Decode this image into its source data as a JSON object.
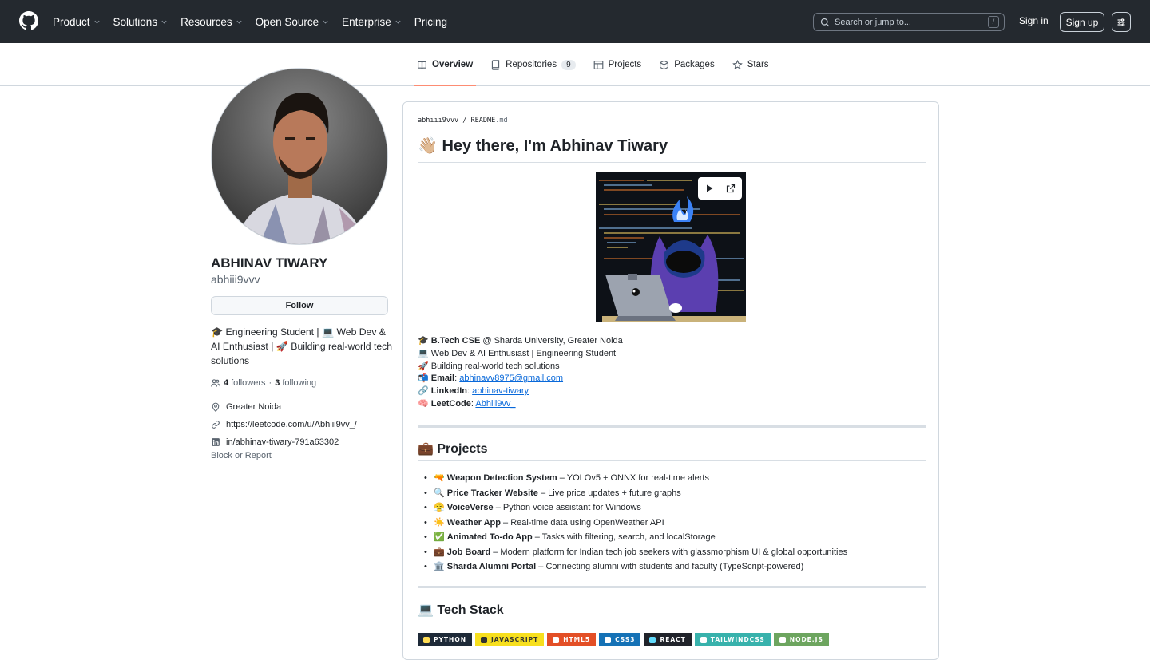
{
  "header": {
    "nav": [
      "Product",
      "Solutions",
      "Resources",
      "Open Source",
      "Enterprise",
      "Pricing"
    ],
    "nav_has_menu": [
      true,
      true,
      true,
      true,
      true,
      false
    ],
    "search_placeholder": "Search or jump to...",
    "search_shortcut": "/",
    "signin": "Sign in",
    "signup": "Sign up"
  },
  "tabs": [
    {
      "label": "Overview",
      "icon": "book-icon",
      "active": true
    },
    {
      "label": "Repositories",
      "icon": "repo-icon",
      "count": "9"
    },
    {
      "label": "Projects",
      "icon": "table-icon"
    },
    {
      "label": "Packages",
      "icon": "package-icon"
    },
    {
      "label": "Stars",
      "icon": "star-icon"
    }
  ],
  "profile": {
    "fullname": "ABHINAV TIWARY",
    "username": "abhiii9vvv",
    "follow": "Follow",
    "bio": "🎓 Engineering Student | 💻 Web Dev & AI Enthusiast | 🚀 Building real-world tech solutions",
    "followers_count": "4",
    "followers_label": "followers",
    "sep": "·",
    "following_count": "3",
    "following_label": "following",
    "location": "Greater Noida",
    "website": "https://leetcode.com/u/Abhiii9vv_/",
    "linkedin": "in/abhinav-tiwary-791a63302",
    "block_report": "Block or Report"
  },
  "readme": {
    "path_user": "abhiii9vvv",
    "path_sep": " / ",
    "path_file": "README",
    "path_ext": ".md",
    "title": "👋🏼 Hey there, I'm Abhinav Tiwary",
    "info": [
      {
        "emoji": "🎓",
        "bold": "B.Tech CSE",
        "text": " @ Sharda University, Greater Noida"
      },
      {
        "emoji": "💻",
        "bold": "",
        "text": " Web Dev & AI Enthusiast | Engineering Student"
      },
      {
        "emoji": "🚀",
        "bold": "",
        "text": " Building real-world tech solutions"
      },
      {
        "emoji": "📬",
        "bold": "Email",
        "text": ": ",
        "link": "abhinavv8975@gmail.com"
      },
      {
        "emoji": "🔗",
        "bold": "LinkedIn",
        "text": ": ",
        "link": "abhinav-tiwary"
      },
      {
        "emoji": "🧠",
        "bold": "LeetCode",
        "text": ": ",
        "link": "Abhiii9vv_"
      }
    ],
    "projects_heading": "💼 Projects",
    "projects": [
      {
        "emoji": "🔫",
        "name": "Weapon Detection System",
        "desc": " – YOLOv5 + ONNX for real-time alerts"
      },
      {
        "emoji": "🔍",
        "name": "Price Tracker Website",
        "desc": " – Live price updates + future graphs"
      },
      {
        "emoji": "😤",
        "name": "VoiceVerse",
        "desc": " – Python voice assistant for Windows"
      },
      {
        "emoji": "☀️",
        "name": "Weather App",
        "desc": " – Real-time data using OpenWeather API"
      },
      {
        "emoji": "✅",
        "name": "Animated To-do App",
        "desc": " – Tasks with filtering, search, and localStorage"
      },
      {
        "emoji": "💼",
        "name": "Job Board",
        "desc": " – Modern platform for Indian tech job seekers with glassmorphism UI & global opportunities"
      },
      {
        "emoji": "🏛️",
        "name": "Sharda Alumni Portal",
        "desc": " – Connecting alumni with students and faculty (TypeScript-powered)"
      }
    ],
    "tech_heading": "💻 Tech Stack",
    "badges": [
      {
        "label": "PYTHON",
        "bg": "#3670a0",
        "dark": "#1e2a38",
        "icon": "#ffdd54"
      },
      {
        "label": "JAVASCRIPT",
        "bg": "#f7df1e",
        "text": "#323330",
        "icon": "#323330"
      },
      {
        "label": "HTML5",
        "bg": "#e34f26",
        "icon": "#ffffff"
      },
      {
        "label": "CSS3",
        "bg": "#1572b6",
        "icon": "#ffffff"
      },
      {
        "label": "REACT",
        "bg": "#20232a",
        "icon": "#61dafb"
      },
      {
        "label": "TAILWINDCSS",
        "bg": "#38b2ac",
        "icon": "#ffffff"
      },
      {
        "label": "NODE.JS",
        "bg": "#6da55f",
        "icon": "#ffffff"
      }
    ]
  },
  "colors": {
    "header_bg": "#24292f",
    "link": "#0969da",
    "tab_underline": "#fd8c73"
  }
}
